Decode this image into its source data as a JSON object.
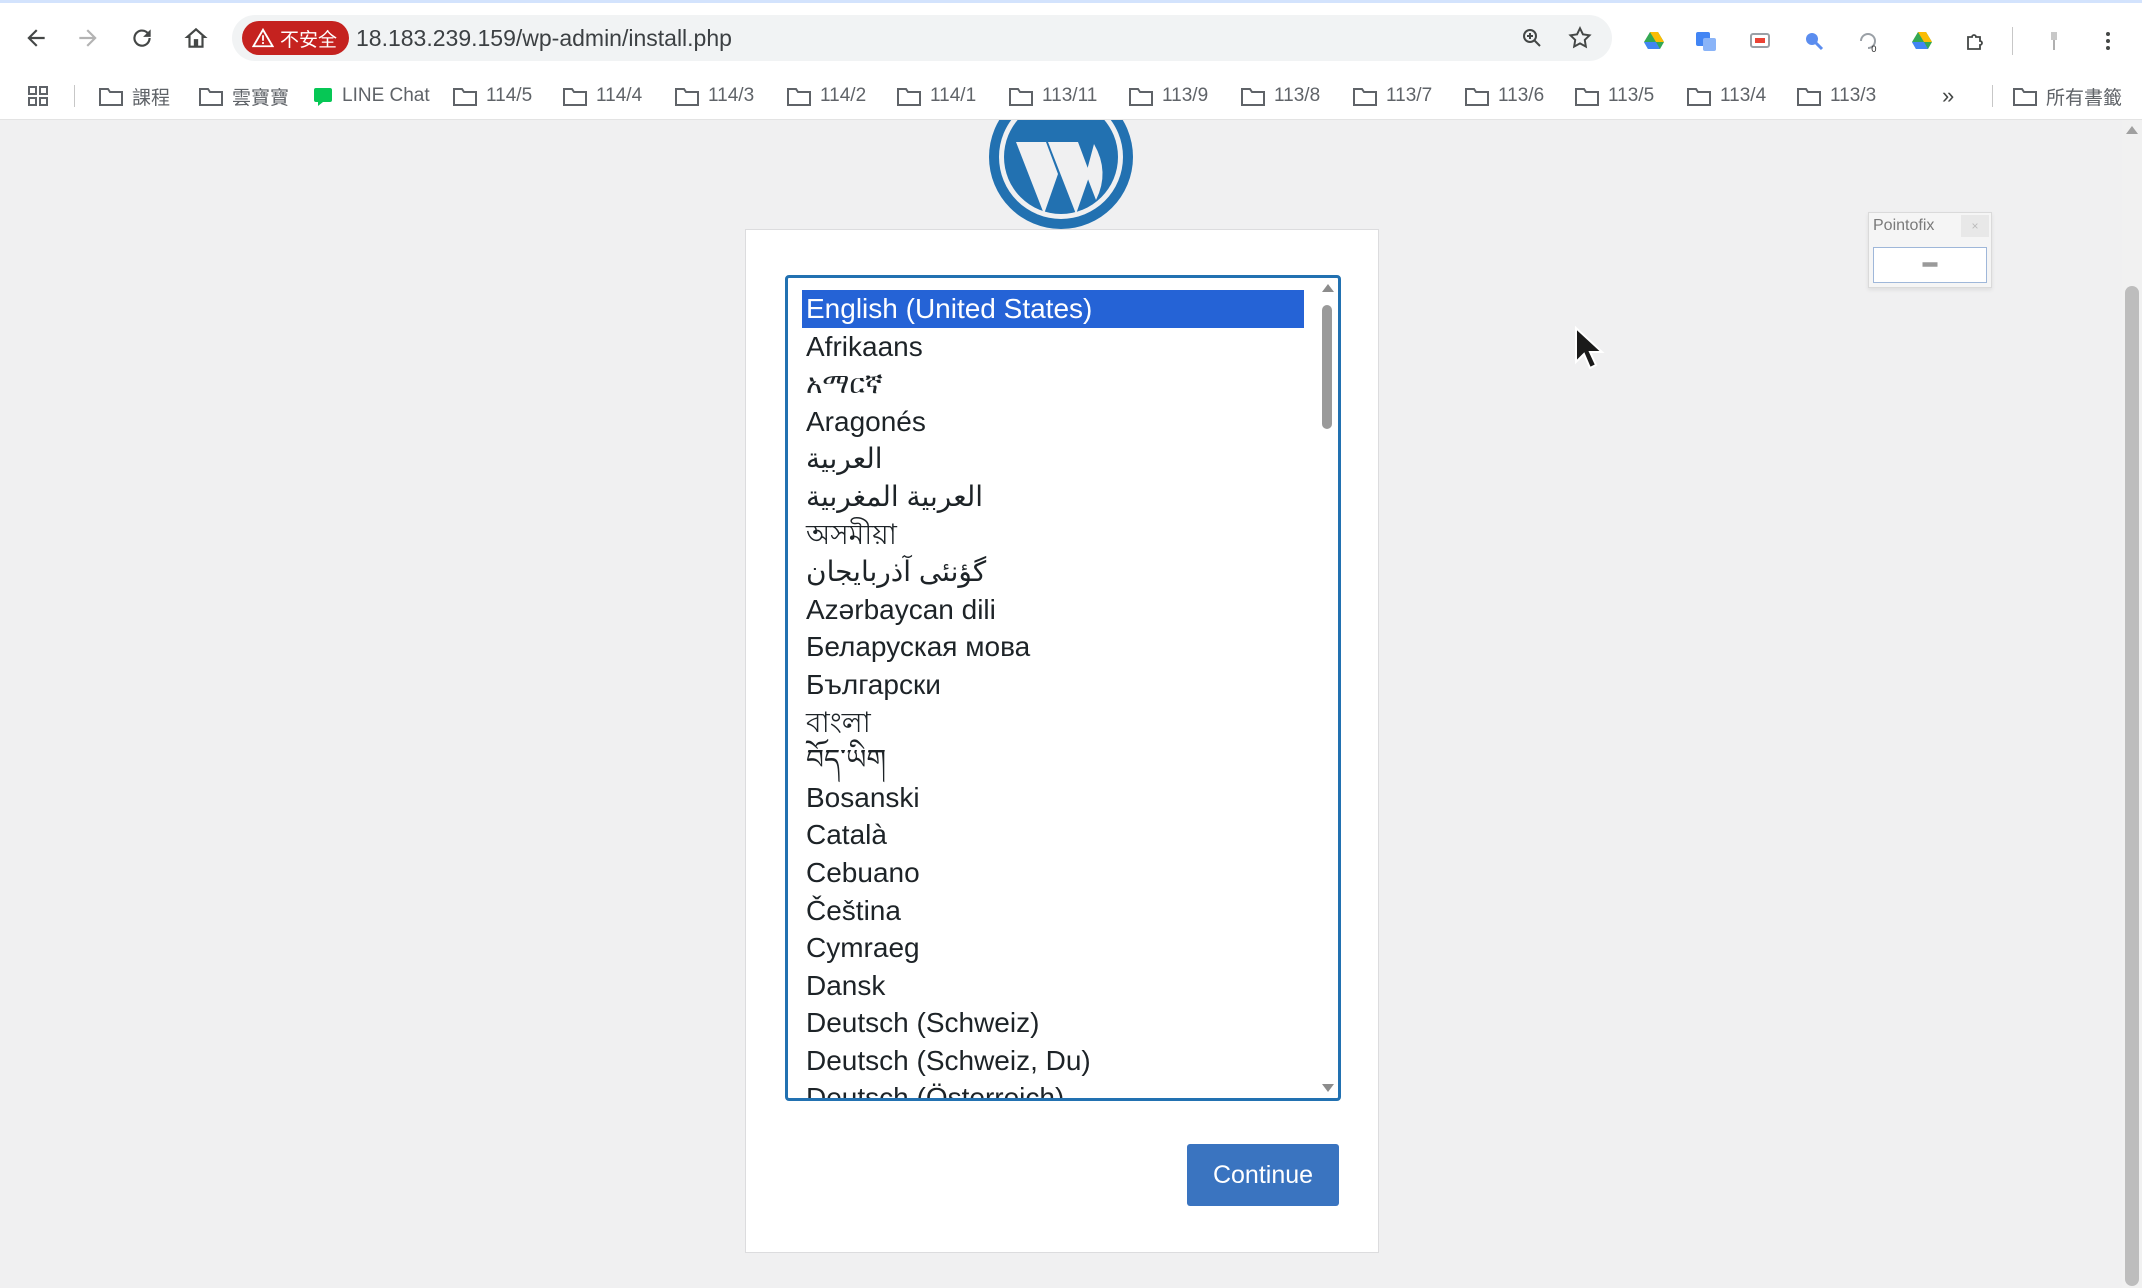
{
  "browser": {
    "security_label": "不安全",
    "url": "18.183.239.159/wp-admin/install.php",
    "bookmarks": [
      {
        "label": "課程",
        "type": "folder"
      },
      {
        "label": "雲寶寶",
        "type": "folder"
      },
      {
        "label": "LINE Chat",
        "type": "link"
      },
      {
        "label": "114/5",
        "type": "folder"
      },
      {
        "label": "114/4",
        "type": "folder"
      },
      {
        "label": "114/3",
        "type": "folder"
      },
      {
        "label": "114/2",
        "type": "folder"
      },
      {
        "label": "114/1",
        "type": "folder"
      },
      {
        "label": "113/11",
        "type": "folder"
      },
      {
        "label": "113/9",
        "type": "folder"
      },
      {
        "label": "113/8",
        "type": "folder"
      },
      {
        "label": "113/7",
        "type": "folder"
      },
      {
        "label": "113/6",
        "type": "folder"
      },
      {
        "label": "113/5",
        "type": "folder"
      },
      {
        "label": "113/4",
        "type": "folder"
      },
      {
        "label": "113/3",
        "type": "folder"
      }
    ],
    "overflow_label": "»",
    "all_bookmarks_label": "所有書籤"
  },
  "installer": {
    "selected_language": "English (United States)",
    "languages": [
      "English (United States)",
      "Afrikaans",
      "አማርኛ",
      "Aragonés",
      "العربية",
      "العربية المغربية",
      "অসমীয়া",
      "گؤنئی آذربایجان",
      "Azərbaycan dili",
      "Беларуская мова",
      "Български",
      "বাংলা",
      "བོད་ཡིག",
      "Bosanski",
      "Català",
      "Cebuano",
      "Čeština",
      "Cymraeg",
      "Dansk",
      "Deutsch (Schweiz)",
      "Deutsch (Schweiz, Du)",
      "Deutsch (Österreich)"
    ],
    "continue_label": "Continue"
  },
  "overlay": {
    "pointofix_title": "Pointofix",
    "pointofix_close": "×",
    "pointofix_body": "Pointofix"
  },
  "colors": {
    "accent": "#2271b1",
    "button": "#3a74c0",
    "selection": "#2563d6",
    "security": "#c5221f"
  }
}
